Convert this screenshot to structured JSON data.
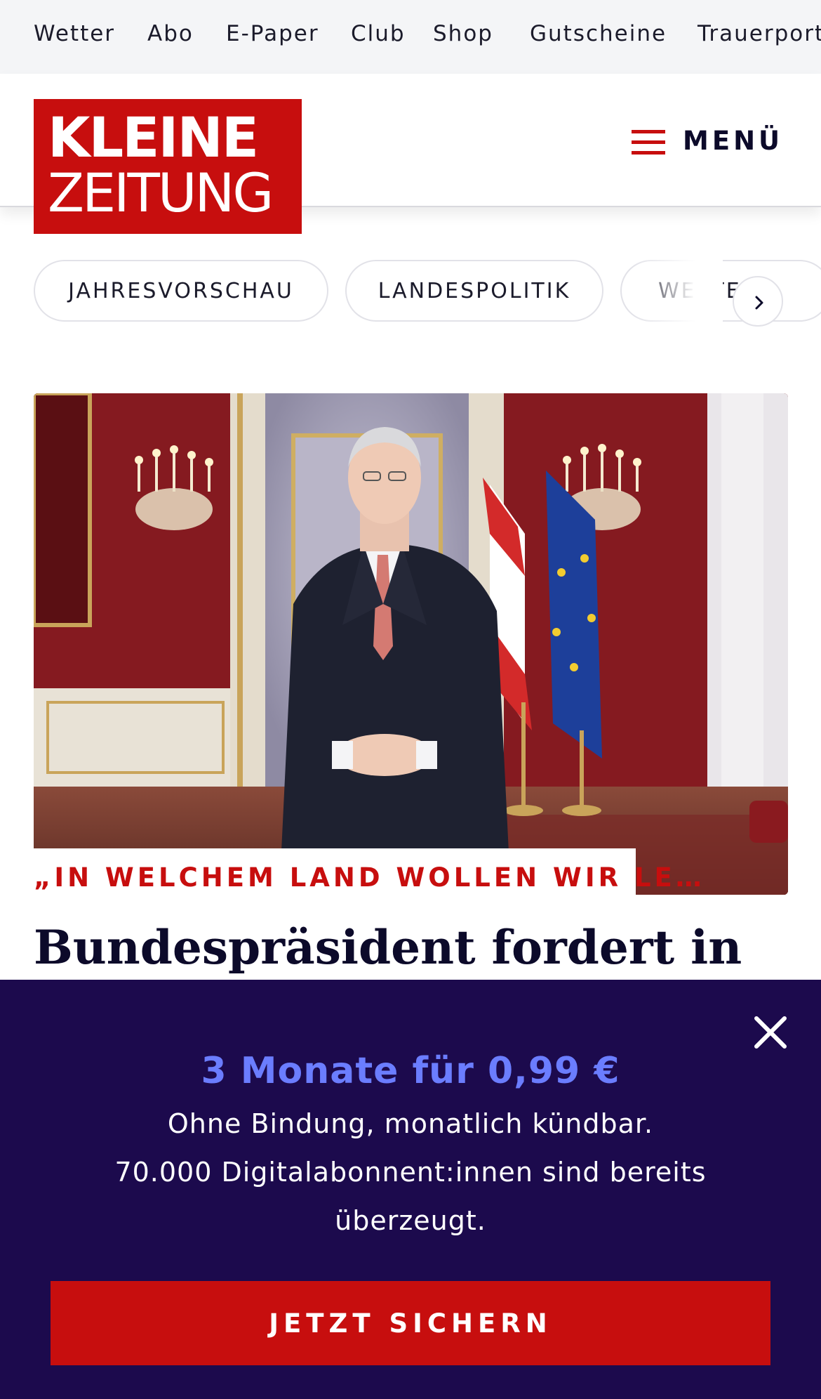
{
  "topnav": {
    "items": [
      {
        "label": "Wetter"
      },
      {
        "label": "Abo"
      },
      {
        "label": "E-Paper"
      },
      {
        "label": "Club"
      },
      {
        "label": "Shop"
      },
      {
        "label": "Gutscheine"
      },
      {
        "label": "Trauerportal"
      }
    ]
  },
  "header": {
    "logo": {
      "line1": "KLEINE",
      "line2": "ZEITUNG"
    },
    "menu_label": "MENÜ"
  },
  "chips": [
    {
      "label": "JAHRESVORSCHAU"
    },
    {
      "label": "LANDESPOLITIK"
    },
    {
      "label": "WETTER"
    }
  ],
  "article": {
    "kicker": "„IN WELCHEM LAND WOLLEN WIR LE…",
    "headline": "Bundespräsident fordert in"
  },
  "offer": {
    "title": "3 Monate für 0,99 €",
    "line1": "Ohne Bindung, monatlich kündbar.",
    "line2": "70.000 Digitalabonnent:innen sind bereits",
    "line3": "überzeugt.",
    "cta_label": "JETZT SICHERN"
  },
  "icons": {
    "menu": "hamburger-icon",
    "next": "chevron-right-icon",
    "close": "close-icon"
  },
  "colors": {
    "brand_red": "#c70e0e",
    "overlay_bg": "#1c0a4d",
    "offer_accent": "#6b7dff",
    "text_dark": "#0c0a2a"
  }
}
